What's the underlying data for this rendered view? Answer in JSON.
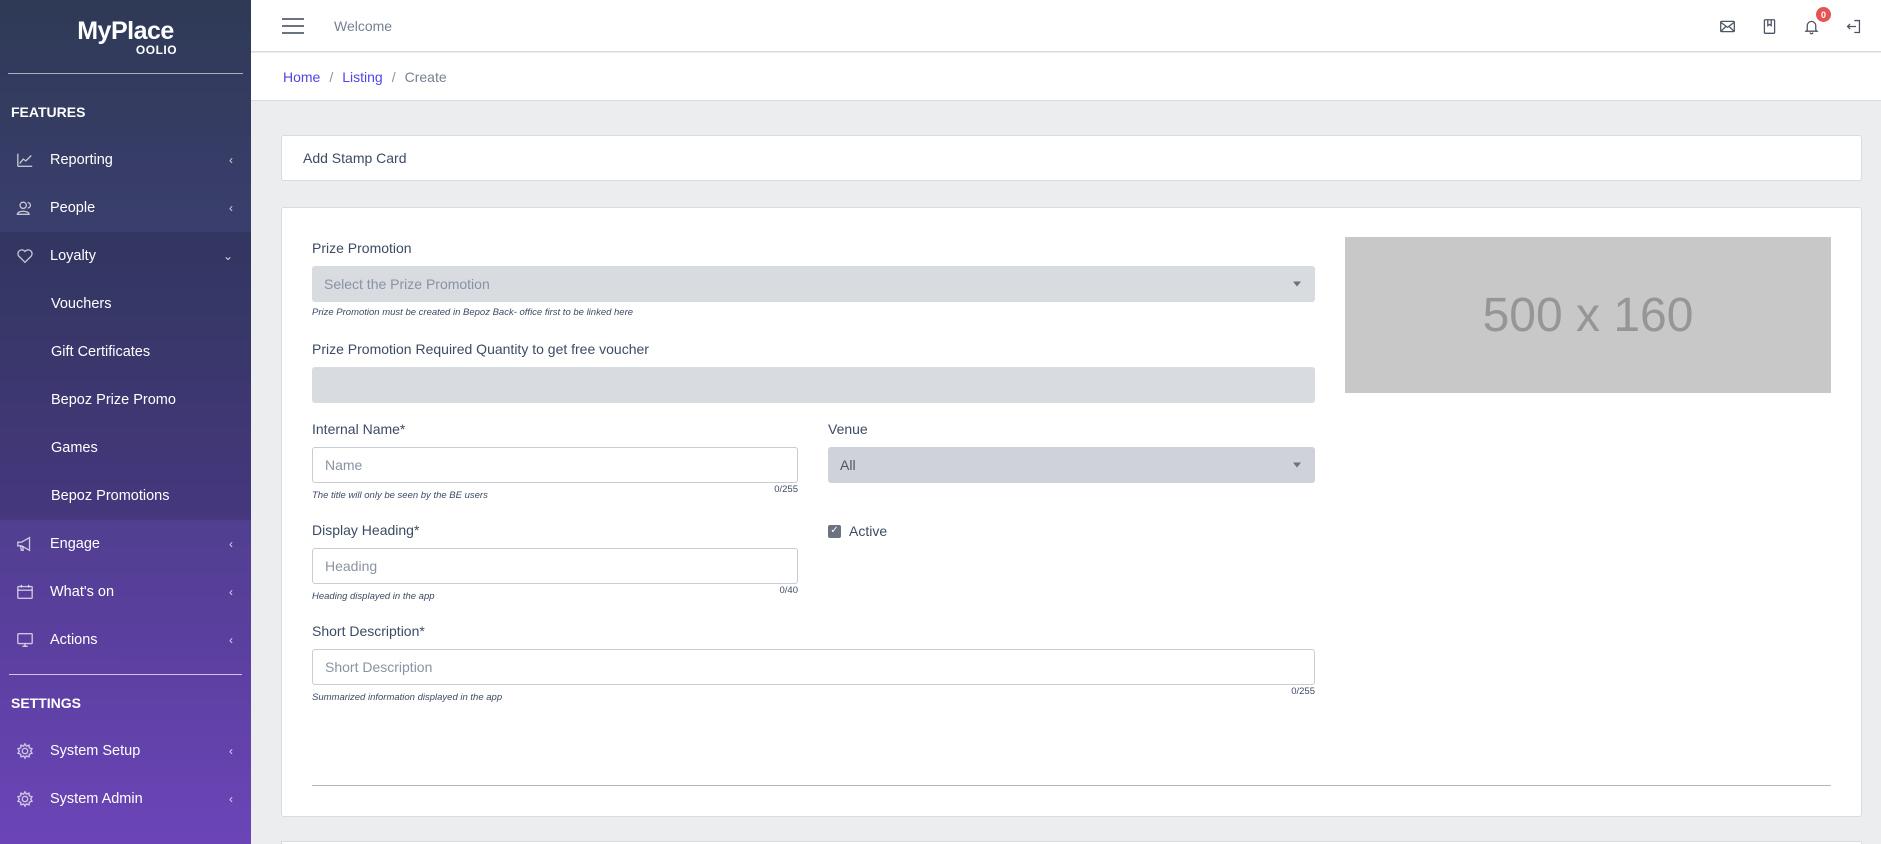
{
  "brand": {
    "name": "MyPlace",
    "sub": "OOLIO"
  },
  "sidebar": {
    "features_title": "FEATURES",
    "settings_title": "SETTINGS",
    "items": [
      {
        "label": "Reporting",
        "icon": "chart-icon"
      },
      {
        "label": "People",
        "icon": "people-icon"
      },
      {
        "label": "Loyalty",
        "icon": "heart-icon"
      }
    ],
    "loyalty_sub": [
      {
        "label": "Vouchers"
      },
      {
        "label": "Gift Certificates"
      },
      {
        "label": "Bepoz Prize Promo"
      },
      {
        "label": "Games"
      },
      {
        "label": "Bepoz Promotions"
      }
    ],
    "items_after": [
      {
        "label": "Engage",
        "icon": "megaphone-icon"
      },
      {
        "label": "What's on",
        "icon": "calendar-icon"
      },
      {
        "label": "Actions",
        "icon": "monitor-icon"
      }
    ],
    "settings_items": [
      {
        "label": "System Setup",
        "icon": "gear-icon"
      },
      {
        "label": "System Admin",
        "icon": "gear-icon"
      }
    ]
  },
  "header": {
    "welcome": "Welcome",
    "notification_count": "0"
  },
  "breadcrumb": {
    "home": "Home",
    "listing": "Listing",
    "current": "Create"
  },
  "page": {
    "title": "Add Stamp Card"
  },
  "form": {
    "prize_promotion": {
      "label": "Prize Promotion",
      "placeholder": "Select the Prize Promotion",
      "help": "Prize Promotion must be created in Bepoz Back- office first to be linked here"
    },
    "required_quantity": {
      "label": "Prize Promotion Required Quantity to get free voucher",
      "value": ""
    },
    "internal_name": {
      "label": "Internal Name*",
      "placeholder": "Name",
      "help": "The title will only be seen by the BE users",
      "counter": "0/255"
    },
    "venue": {
      "label": "Venue",
      "value": "All"
    },
    "display_heading": {
      "label": "Display Heading*",
      "placeholder": "Heading",
      "help": "Heading displayed in the app",
      "counter": "0/40"
    },
    "active": {
      "label": "Active",
      "checked": true
    },
    "short_description": {
      "label": "Short Description*",
      "placeholder": "Short Description",
      "help": "Summarized information displayed in the app",
      "counter": "0/255"
    },
    "image_placeholder": "500 x 160"
  }
}
